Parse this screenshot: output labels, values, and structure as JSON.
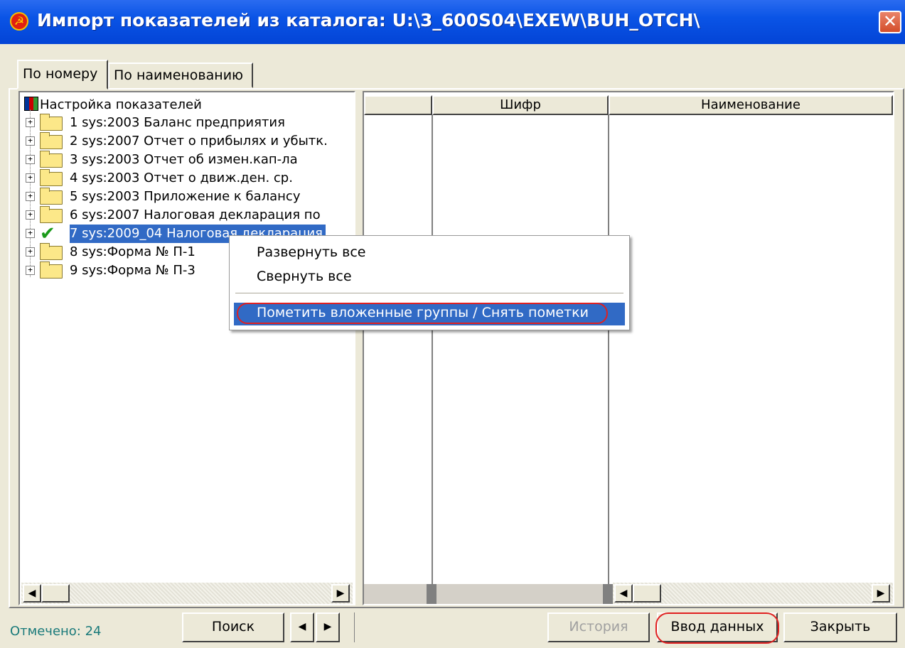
{
  "window": {
    "title": "Импорт показателей из каталога:  U:\\3_600S04\\EXEW\\BUH_OTCH\\",
    "close_label": "✕"
  },
  "tabs": [
    {
      "label": "По номеру",
      "active": true
    },
    {
      "label": "По наименованию",
      "active": false
    }
  ],
  "tree": {
    "root_label": "Настройка показателей",
    "items": [
      {
        "label": "1  sys:2003 Баланс предприятия",
        "icon": "folder-icon"
      },
      {
        "label": "2  sys:2007 Отчет о прибылях и убытк.",
        "icon": "folder-icon"
      },
      {
        "label": "3  sys:2003 Отчет об измен.кап-ла",
        "icon": "folder-icon"
      },
      {
        "label": "4  sys:2003 Отчет о движ.ден. ср.",
        "icon": "folder-icon"
      },
      {
        "label": "5  sys:2003 Приложение к балансу",
        "icon": "folder-icon"
      },
      {
        "label": "6  sys:2007 Налоговая декларация по",
        "icon": "folder-icon"
      },
      {
        "label": "7  sys:2009_04 Налоговая декларация",
        "icon": "check-icon",
        "selected": true
      },
      {
        "label": "8  sys:Форма № П-1",
        "icon": "folder-icon"
      },
      {
        "label": "9  sys:Форма № П-3",
        "icon": "folder-icon"
      }
    ]
  },
  "grid": {
    "columns": [
      "",
      "Шифр",
      "Наименование"
    ]
  },
  "context_menu": {
    "items": [
      "Развернуть все",
      "Свернуть все"
    ],
    "highlighted": "Пометить вложенные группы / Снять пометки"
  },
  "status": {
    "checked_text": "Отмечено: 24"
  },
  "buttons": {
    "search": "Поиск",
    "prev": "◀",
    "next": "▶",
    "history": "История",
    "data_entry": "Ввод данных",
    "close": "Закрыть"
  },
  "colors": {
    "title_bar": "#0a54e6",
    "selection": "#316ac5",
    "annotation_oval": "#e02020",
    "status_text": "#1a7a7a"
  }
}
